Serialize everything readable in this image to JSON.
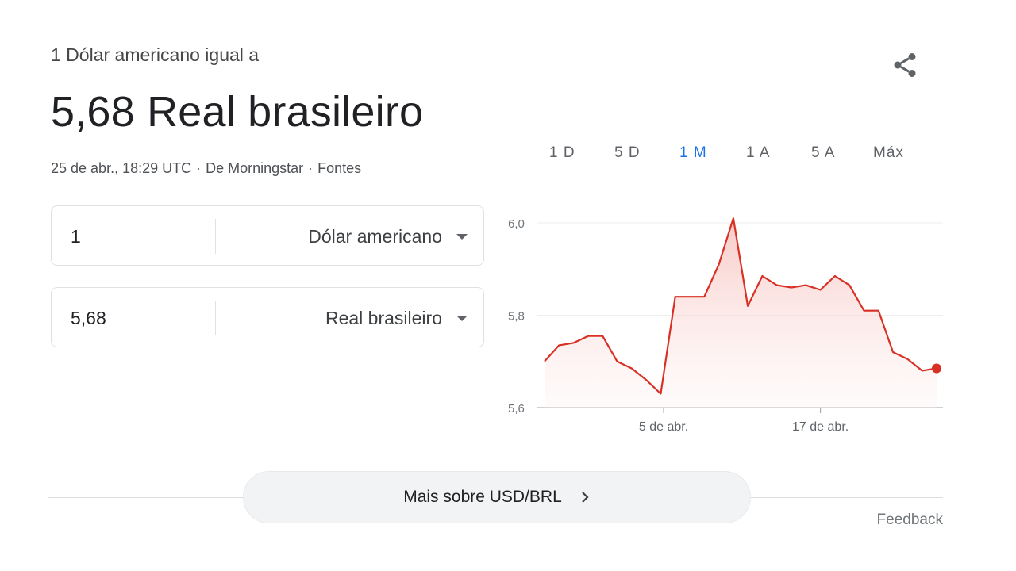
{
  "header": {
    "subtitle": "1 Dólar americano igual a",
    "headline": "5,68 Real brasileiro",
    "timestamp": "25 de abr., 18:29 UTC",
    "separator": "·",
    "source": "De Morningstar",
    "sources_link": "Fontes"
  },
  "icons": {
    "share": "share-icon",
    "caret": "caret-down-icon",
    "chevron": "chevron-right-icon"
  },
  "converter": {
    "from": {
      "value": "1",
      "currency": "Dólar americano"
    },
    "to": {
      "value": "5,68",
      "currency": "Real brasileiro"
    }
  },
  "ranges": [
    "1 D",
    "5 D",
    "1 M",
    "1 A",
    "5 A",
    "Máx"
  ],
  "active_range": "1 M",
  "colors": {
    "line": "#d93025",
    "fill": "#f9d6d3",
    "accent": "#1a73e8"
  },
  "chart_data": {
    "type": "area",
    "title": "",
    "xlabel": "",
    "ylabel": "",
    "ylim": [
      5.6,
      6.0
    ],
    "yticks": [
      "6,0",
      "5,8",
      "5,6"
    ],
    "xticks": [
      "5 de abr.",
      "17 de abr."
    ],
    "series": [
      {
        "values": [
          5.7,
          5.735,
          5.74,
          5.755,
          5.755,
          5.7,
          5.685,
          5.66,
          5.63,
          5.84,
          5.84,
          5.84,
          5.91,
          6.01,
          5.82,
          5.885,
          5.865,
          5.86,
          5.865,
          5.855,
          5.885,
          5.865,
          5.81,
          5.81,
          5.72,
          5.705,
          5.68,
          5.685
        ]
      }
    ],
    "grid": true
  },
  "footer": {
    "more_label": "Mais sobre USD/BRL",
    "feedback": "Feedback"
  }
}
